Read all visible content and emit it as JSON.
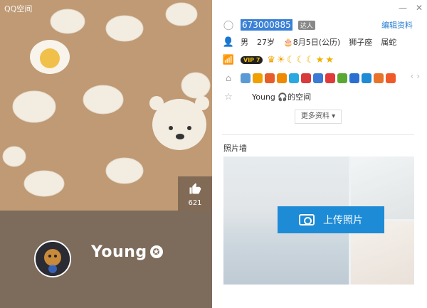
{
  "cover": {
    "title": "QQ空间",
    "likes": "621",
    "nickname": "Young"
  },
  "window": {
    "minimize_icon": "minimize-icon",
    "close_icon": "close-icon"
  },
  "profile": {
    "qq_number": "673000885",
    "daren_tag": "达人",
    "edit_label": "编辑资料",
    "gender": "男",
    "age": "27岁",
    "birthday": "8月5日(公历)",
    "zodiac": "狮子座",
    "chinese_zodiac": "属蛇",
    "vip_label": "VIP 7",
    "level_icons": [
      "crown",
      "sun",
      "moon",
      "moon",
      "moon",
      "star",
      "star"
    ],
    "space_name": "Young 🎧的空间",
    "more_label": "更多资料 ▾"
  },
  "wall": {
    "title": "照片墙",
    "upload_label": "上传照片"
  },
  "colors": {
    "accent": "#1d8bd6",
    "cover_bg": "#bf9a74",
    "cover_bottom": "#7d6b5c"
  }
}
